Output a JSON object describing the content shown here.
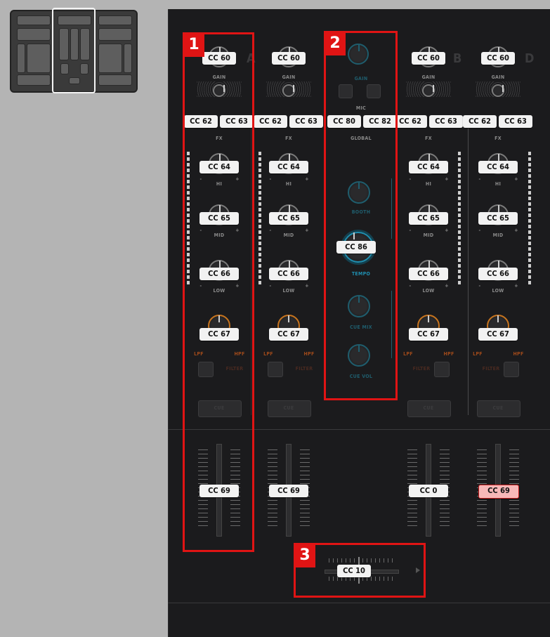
{
  "thumbnail": {
    "label": ""
  },
  "channels": {
    "ch1": {
      "gain": "CC 60",
      "fx1": "CC 62",
      "fx2": "CC 63",
      "hi": "CC 64",
      "mid": "CC 65",
      "low": "CC 66",
      "filter": "CC 67",
      "fader": "CC 69"
    },
    "ch2": {
      "gain": "CC 60",
      "fx1": "CC 62",
      "fx2": "CC 63",
      "hi": "CC 64",
      "mid": "CC 65",
      "low": "CC 66",
      "filter": "CC 67",
      "fader": "CC 69"
    },
    "ch3": {
      "gain": "CC 60",
      "fx1": "CC 62",
      "fx2": "CC 63",
      "hi": "CC 64",
      "mid": "CC 65",
      "low": "CC 66",
      "filter": "CC 67",
      "fader": "CC 0"
    },
    "ch4": {
      "gain": "CC 60",
      "fx1": "CC 62",
      "fx2": "CC 63",
      "hi": "CC 64",
      "mid": "CC 65",
      "low": "CC 66",
      "filter": "CC 67",
      "fader": "CC 69"
    }
  },
  "center": {
    "global1": "CC 80",
    "global2": "CC 82",
    "tempo": "CC 86"
  },
  "crossfader": {
    "label": "CC 10"
  },
  "labels": {
    "gain": "GAIN",
    "fx": "FX",
    "hi": "HI",
    "mid": "MID",
    "low": "LOW",
    "lpf": "LPF",
    "hpf": "HPF",
    "filter": "FILTER",
    "cue": "CUE",
    "mic": "MIC",
    "global": "GLOBAL",
    "tempo": "TEMPO",
    "cue_mix": "CUE MIX",
    "cue_vol": "CUE VOL",
    "booth": "BOOTH",
    "minus": "-",
    "plus": "+",
    "deck_a": "A",
    "deck_b": "B",
    "deck_d": "D"
  },
  "callouts": {
    "one": "1",
    "two": "2",
    "three": "3"
  },
  "colors": {
    "callout": "#e01414",
    "selected_fill": "#f7b8b8",
    "mixer_bg": "#1b1b1d",
    "page_bg": "#b4b4b4"
  }
}
